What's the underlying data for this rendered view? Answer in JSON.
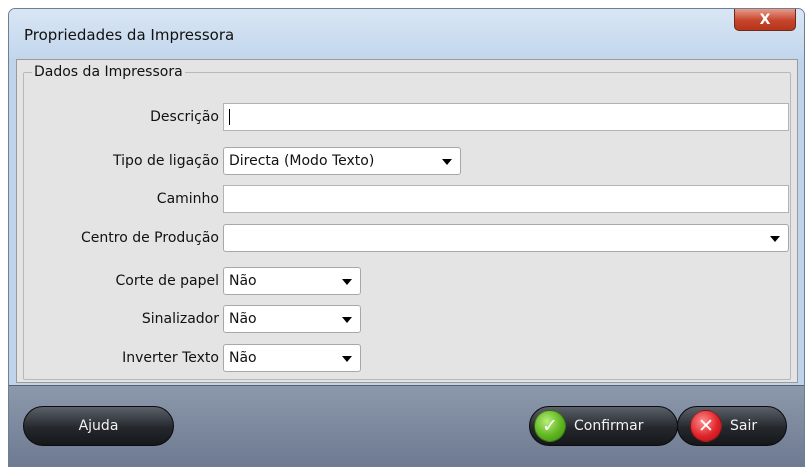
{
  "window": {
    "title": "Propriedades da Impressora",
    "close_glyph": "X"
  },
  "group": {
    "title": "Dados da Impressora"
  },
  "fields": {
    "descricao": {
      "label": "Descrição",
      "value": ""
    },
    "tipo_ligacao": {
      "label": "Tipo de ligação",
      "value": "Directa (Modo Texto)"
    },
    "caminho": {
      "label": "Caminho",
      "value": ""
    },
    "centro_producao": {
      "label": "Centro de Produção",
      "value": ""
    },
    "corte_papel": {
      "label": "Corte de papel",
      "value": "Não"
    },
    "sinalizador": {
      "label": "Sinalizador",
      "value": "Não"
    },
    "inverter_texto": {
      "label": "Inverter Texto",
      "value": "Não"
    }
  },
  "buttons": {
    "help": "Ajuda",
    "confirm": "Confirmar",
    "exit": "Sair"
  },
  "icons": {
    "confirm": "check-icon",
    "exit": "x-icon",
    "dropdown": "chevron-down-icon"
  },
  "colors": {
    "title_bar": "#c8dbef",
    "footer": "#7b879b",
    "close_button": "#c7442c",
    "confirm_icon": "#5fb521",
    "exit_icon": "#e0252b",
    "button_dark": "#24272c"
  }
}
